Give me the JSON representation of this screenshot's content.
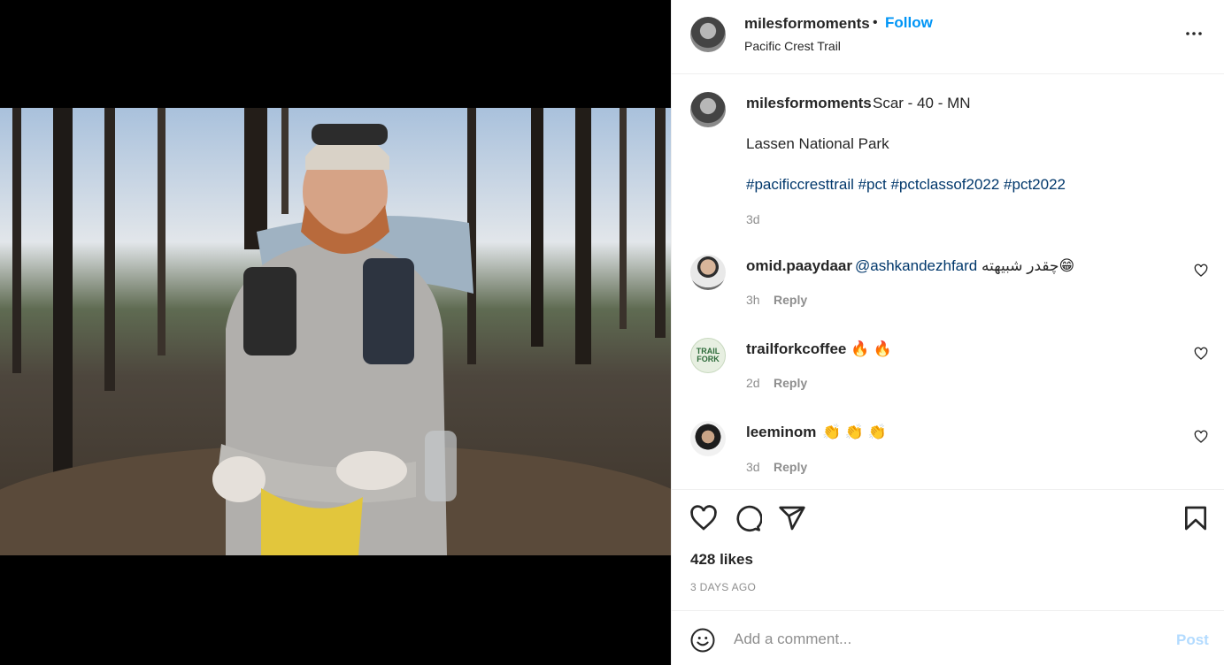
{
  "post": {
    "username": "milesformoments",
    "follow_label": "Follow",
    "location": "Pacific Crest Trail",
    "more_icon": "more-horizontal-icon",
    "dot": "•"
  },
  "caption": {
    "username": "milesformoments",
    "text": "Scar - 40 - MN",
    "line2": "Lassen National Park",
    "hashtags": "#pacificcresttrail #pct #pctclassof2022 #pct2022",
    "time": "3d"
  },
  "comments": [
    {
      "username": "omid.paaydaar",
      "mention": "@ashkandezhfard",
      "text": "چقدر شبیهته😁",
      "time": "3h",
      "reply": "Reply"
    },
    {
      "username": "trailforkcoffee",
      "mention": "",
      "text": "🔥 🔥",
      "time": "2d",
      "reply": "Reply"
    },
    {
      "username": "leeminom",
      "mention": "",
      "text": "👏 👏 👏",
      "time": "3d",
      "reply": "Reply"
    }
  ],
  "avatar_logo": {
    "line1": "TRAIL",
    "line2": "FORK"
  },
  "actions": {
    "likes": "428 likes",
    "posted": "3 DAYS AGO",
    "icons": [
      "heart-icon",
      "comment-icon",
      "share-icon",
      "bookmark-icon"
    ]
  },
  "composer": {
    "placeholder": "Add a comment...",
    "post_label": "Post"
  },
  "colors": {
    "follow": "#0095f6",
    "link": "#00376b",
    "muted": "#8e8e8e",
    "post_disabled": "#b3dbff"
  }
}
